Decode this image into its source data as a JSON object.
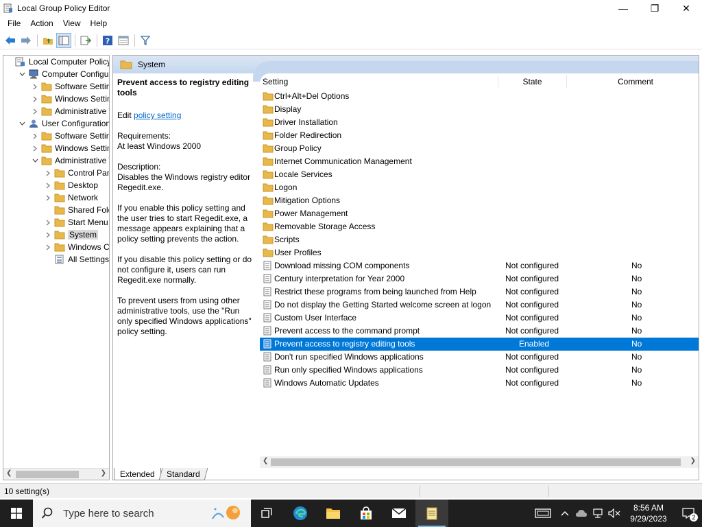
{
  "window": {
    "title": "Local Group Policy Editor",
    "minimize": "—",
    "restore": "❐",
    "close": "✕"
  },
  "menu": [
    "File",
    "Action",
    "View",
    "Help"
  ],
  "tree": {
    "items": [
      {
        "label": "Local Computer Policy",
        "level": 0,
        "expander": "",
        "icon": "computer-policy-icon"
      },
      {
        "label": "Computer Configura",
        "level": 1,
        "expander": "open",
        "icon": "computer-icon"
      },
      {
        "label": "Software Settings",
        "level": 2,
        "expander": "closed",
        "icon": "folder-icon"
      },
      {
        "label": "Windows Setting",
        "level": 2,
        "expander": "closed",
        "icon": "folder-icon"
      },
      {
        "label": "Administrative Te",
        "level": 2,
        "expander": "closed",
        "icon": "folder-icon"
      },
      {
        "label": "User Configuration",
        "level": 1,
        "expander": "open",
        "icon": "user-icon"
      },
      {
        "label": "Software Settings",
        "level": 2,
        "expander": "closed",
        "icon": "folder-icon"
      },
      {
        "label": "Windows Setting",
        "level": 2,
        "expander": "closed",
        "icon": "folder-icon"
      },
      {
        "label": "Administrative Te",
        "level": 2,
        "expander": "open",
        "icon": "folder-icon"
      },
      {
        "label": "Control Panel",
        "level": 3,
        "expander": "closed",
        "icon": "folder-icon"
      },
      {
        "label": "Desktop",
        "level": 3,
        "expander": "closed",
        "icon": "folder-icon"
      },
      {
        "label": "Network",
        "level": 3,
        "expander": "closed",
        "icon": "folder-icon"
      },
      {
        "label": "Shared Folder",
        "level": 3,
        "expander": "",
        "icon": "folder-icon"
      },
      {
        "label": "Start Menu ar",
        "level": 3,
        "expander": "closed",
        "icon": "folder-icon"
      },
      {
        "label": "System",
        "level": 3,
        "expander": "closed",
        "icon": "folder-icon",
        "selected": true
      },
      {
        "label": "Windows Cor",
        "level": 3,
        "expander": "closed",
        "icon": "folder-icon"
      },
      {
        "label": "All Settings",
        "level": 3,
        "expander": "",
        "icon": "all-settings-icon"
      }
    ]
  },
  "header": {
    "title": "System"
  },
  "description": {
    "title": "Prevent access to registry editing tools",
    "edit_prefix": "Edit ",
    "edit_link": "policy setting ",
    "requirements_label": "Requirements:",
    "requirements_value": "At least Windows 2000",
    "description_label": "Description:",
    "description_text": "Disables the Windows registry editor Regedit.exe.",
    "p1": "If you enable this policy setting and the user tries to start Regedit.exe, a message appears explaining that a policy setting prevents the action.",
    "p2": "If you disable this policy setting or do not configure it, users can run Regedit.exe normally.",
    "p3": "To prevent users from using other administrative tools, use the \"Run only specified Windows applications\" policy setting."
  },
  "columns": {
    "setting": "Setting",
    "state": "State",
    "comment": "Comment"
  },
  "rows": [
    {
      "name": "Ctrl+Alt+Del Options",
      "type": "folder",
      "state": "",
      "comment": ""
    },
    {
      "name": "Display",
      "type": "folder",
      "state": "",
      "comment": ""
    },
    {
      "name": "Driver Installation",
      "type": "folder",
      "state": "",
      "comment": ""
    },
    {
      "name": "Folder Redirection",
      "type": "folder",
      "state": "",
      "comment": ""
    },
    {
      "name": "Group Policy",
      "type": "folder",
      "state": "",
      "comment": ""
    },
    {
      "name": "Internet Communication Management",
      "type": "folder",
      "state": "",
      "comment": ""
    },
    {
      "name": "Locale Services",
      "type": "folder",
      "state": "",
      "comment": ""
    },
    {
      "name": "Logon",
      "type": "folder",
      "state": "",
      "comment": ""
    },
    {
      "name": "Mitigation Options",
      "type": "folder",
      "state": "",
      "comment": ""
    },
    {
      "name": "Power Management",
      "type": "folder",
      "state": "",
      "comment": ""
    },
    {
      "name": "Removable Storage Access",
      "type": "folder",
      "state": "",
      "comment": ""
    },
    {
      "name": "Scripts",
      "type": "folder",
      "state": "",
      "comment": ""
    },
    {
      "name": "User Profiles",
      "type": "folder",
      "state": "",
      "comment": ""
    },
    {
      "name": "Download missing COM components",
      "type": "setting",
      "state": "Not configured",
      "comment": "No"
    },
    {
      "name": "Century interpretation for Year 2000",
      "type": "setting",
      "state": "Not configured",
      "comment": "No"
    },
    {
      "name": "Restrict these programs from being launched from Help",
      "type": "setting",
      "state": "Not configured",
      "comment": "No"
    },
    {
      "name": "Do not display the Getting Started welcome screen at logon",
      "type": "setting",
      "state": "Not configured",
      "comment": "No"
    },
    {
      "name": "Custom User Interface",
      "type": "setting",
      "state": "Not configured",
      "comment": "No"
    },
    {
      "name": "Prevent access to the command prompt",
      "type": "setting",
      "state": "Not configured",
      "comment": "No"
    },
    {
      "name": "Prevent access to registry editing tools",
      "type": "setting",
      "state": "Enabled",
      "comment": "No",
      "selected": true
    },
    {
      "name": "Don't run specified Windows applications",
      "type": "setting",
      "state": "Not configured",
      "comment": "No"
    },
    {
      "name": "Run only specified Windows applications",
      "type": "setting",
      "state": "Not configured",
      "comment": "No"
    },
    {
      "name": "Windows Automatic Updates",
      "type": "setting",
      "state": "Not configured",
      "comment": "No"
    }
  ],
  "tabs": {
    "extended": "Extended",
    "standard": "Standard"
  },
  "status": {
    "text": "10 setting(s)"
  },
  "taskbar": {
    "search_placeholder": "Type here to search",
    "time": "8:56 AM",
    "date": "9/29/2023",
    "notification_count": "2"
  },
  "colors": {
    "selection": "#0078d7",
    "header_gradient": "#c5d7ee",
    "folder": "#e8b84a",
    "link": "#0066cc"
  }
}
